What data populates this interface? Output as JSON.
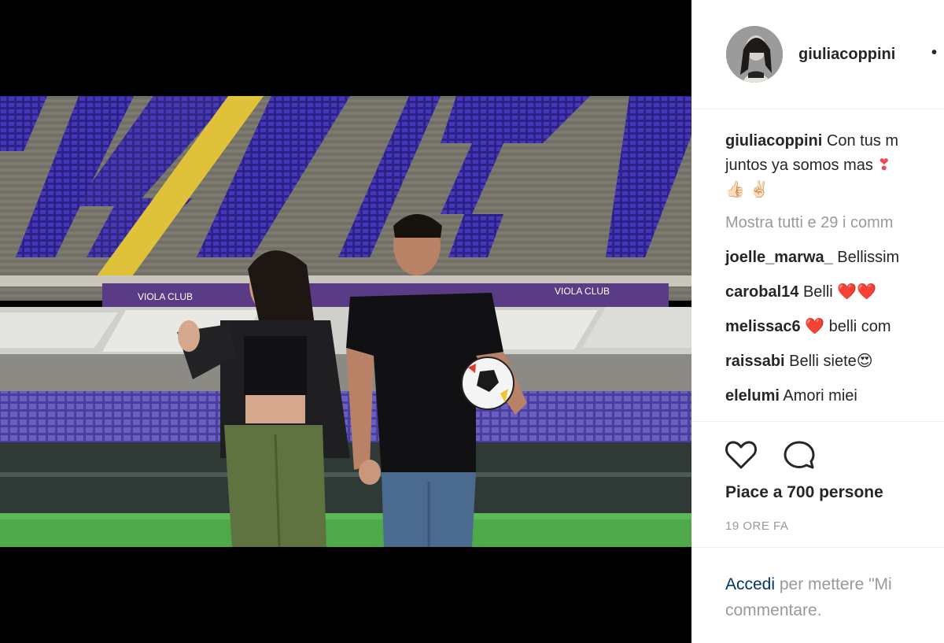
{
  "post": {
    "username": "giuliacoppini",
    "separator": "•",
    "caption_user": "giuliacoppini",
    "caption_text": " Con tus m",
    "caption_line2": "juntos ya somos mas",
    "caption_line3": "👍🏻 ✌🏻",
    "show_all_comments": "Mostra tutti e 29 i comm"
  },
  "comments": [
    {
      "user": "joelle_marwa_",
      "text": " Bellissim"
    },
    {
      "user": "carobal14",
      "text": " Belli ❤️❤️"
    },
    {
      "user": "melissac6",
      "text": " ❤️ belli com"
    },
    {
      "user": "raissabi",
      "text": " Belli siete😍"
    },
    {
      "user": "elelumi",
      "text": " Amori miei"
    }
  ],
  "actions": {
    "like_icon": "heart-outline-icon",
    "comment_icon": "speech-bubble-icon",
    "likes_text": "Piace a 700 persone",
    "timestamp": "19 ORE FA"
  },
  "login": {
    "link": "Accedi",
    "text_line1": " per mettere \"Mi",
    "text_line2": "commentare."
  },
  "colors": {
    "link": "#003569",
    "muted": "#999999",
    "text": "#262626",
    "seat_purple": "#3a2a9a"
  }
}
